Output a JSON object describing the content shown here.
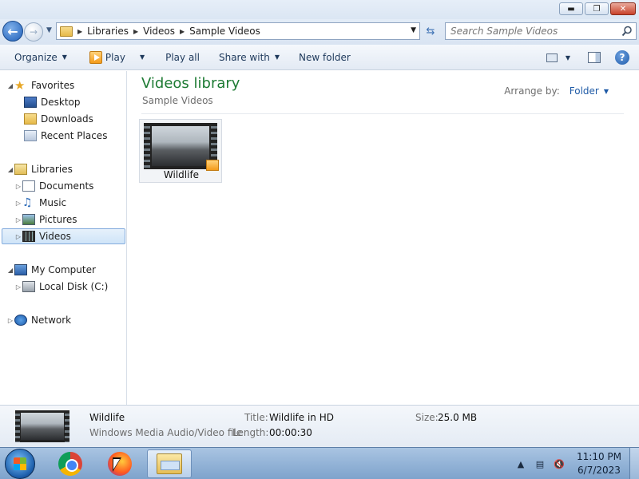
{
  "address": {
    "crumbs": [
      "Libraries",
      "Videos",
      "Sample Videos"
    ]
  },
  "search": {
    "placeholder": "Search Sample Videos"
  },
  "toolbar": {
    "organize": "Organize",
    "play": "Play",
    "play_all": "Play all",
    "share_with": "Share with",
    "new_folder": "New folder"
  },
  "nav": {
    "favorites": "Favorites",
    "desktop": "Desktop",
    "downloads": "Downloads",
    "recent_places": "Recent Places",
    "libraries": "Libraries",
    "documents": "Documents",
    "music": "Music",
    "pictures": "Pictures",
    "videos": "Videos",
    "my_computer": "My Computer",
    "local_disk": "Local Disk (C:)",
    "network": "Network"
  },
  "content": {
    "title": "Videos library",
    "subtitle": "Sample Videos",
    "arrange_label": "Arrange by:",
    "arrange_value": "Folder",
    "files": [
      {
        "name": "Wildlife"
      }
    ]
  },
  "details": {
    "name": "Wildlife",
    "type": "Windows Media Audio/Video file",
    "title_label": "Title:",
    "title_value": "Wildlife in HD",
    "length_label": "Length:",
    "length_value": "00:00:30",
    "size_label": "Size:",
    "size_value": "25.0 MB"
  },
  "taskbar": {
    "time": "11:10 PM",
    "date": "6/7/2023"
  },
  "colors": {
    "library_title": "#1e7b34",
    "selected_nav": "#cfe4f8",
    "taskbar": "#7ea3cc"
  }
}
